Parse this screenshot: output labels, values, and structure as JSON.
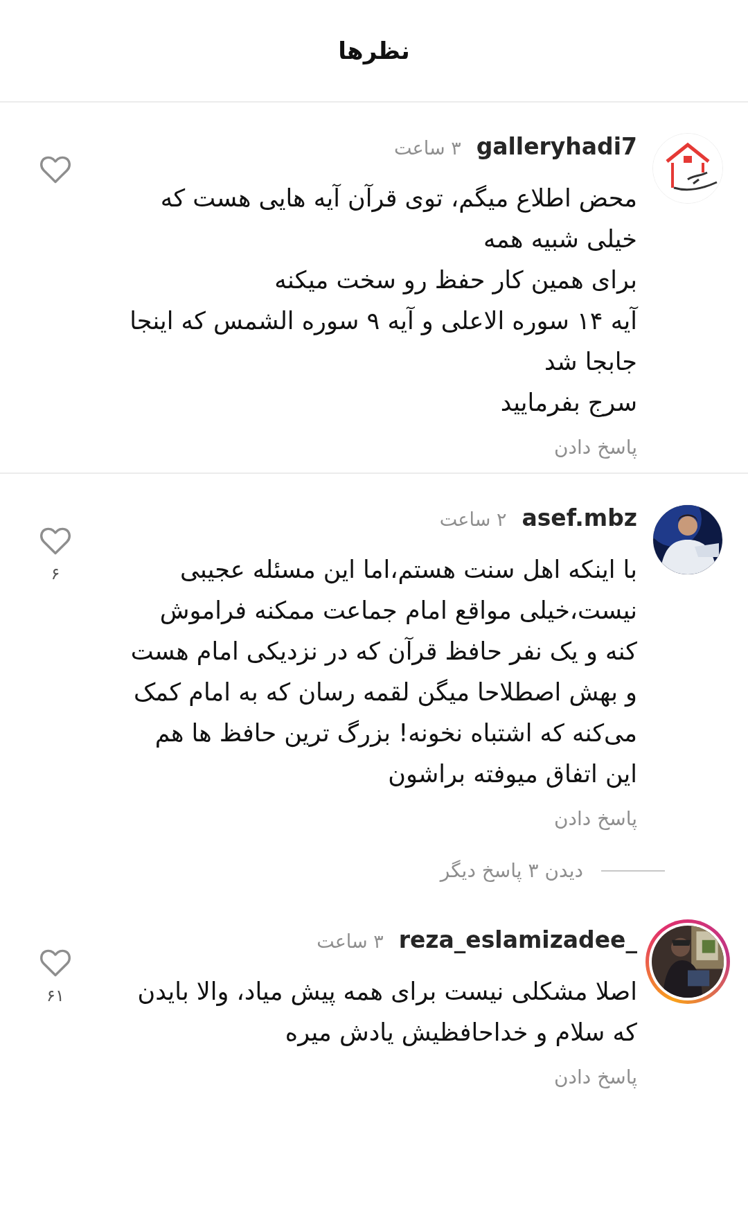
{
  "header": {
    "title": "نظرها"
  },
  "comments": [
    {
      "avatar": {
        "kind": "logo",
        "story_ring": false
      },
      "username": "galleryhadi7",
      "time": "۳ ساعت",
      "body": "محض اطلاع میگم، توی قرآن آیه هایی هست که خیلی شبیه همه\nبرای همین کار حفظ رو سخت میکنه\nآیه ۱۴ سوره الاعلی و آیه ۹ سوره الشمس که اینجا جابجا شد\nسرج بفرمایید",
      "reply": "پاسخ دادن",
      "liked": false,
      "divider_after": true
    },
    {
      "avatar": {
        "kind": "picture",
        "story_ring": false
      },
      "username": "asef.mbz",
      "time": "۲ ساعت",
      "body": "با اینکه اهل سنت هستم،اما این مسئله عجیبی نیست،خیلی مواقع امام جماعت ممکنه فراموش کنه و یک نفر حافظ قرآن که در نزدیکی امام هست و بهش اصطلاحا میگن لقمه رسان که به امام کمک می‌کنه که اشتباه نخونه! بزرگ ترین حافظ ها هم این اتفاق میوفته براشون",
      "reply": "پاسخ دادن",
      "liked": false,
      "likes": "۶",
      "more_replies": "دیدن ۳ پاسخ دیگر",
      "divider_after": false
    },
    {
      "avatar": {
        "kind": "picture",
        "story_ring": true
      },
      "username": "_reza_eslamizadee",
      "time": "۳ ساعت",
      "body": "اصلا مشکلی نیست برای همه پیش میاد، والا بایدن که سلام و خداحافظیش یادش میره",
      "reply": "پاسخ دادن",
      "liked": false,
      "likes": "۶۱",
      "divider_after": false
    }
  ]
}
